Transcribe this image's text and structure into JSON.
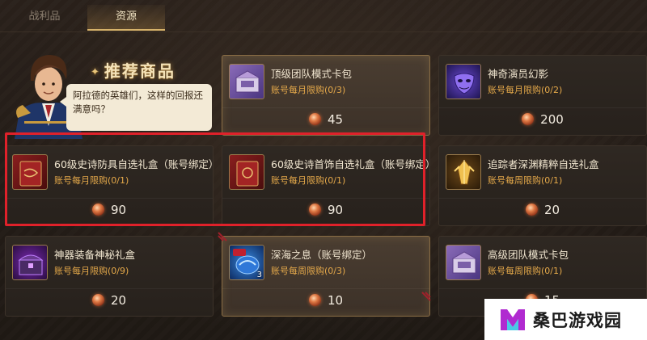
{
  "tabs": [
    {
      "label": "战利品",
      "active": false
    },
    {
      "label": "资源",
      "active": true
    }
  ],
  "promo": {
    "title": "推荐商品",
    "speech": "阿拉德的英雄们，这样的回报还满意吗？"
  },
  "items": [
    {
      "name": "顶级团队模式卡包",
      "limit": "账号每月限购(0/3)",
      "price": "45",
      "icon": "card-pack-box-icon",
      "selected": true
    },
    {
      "name": "神奇演员幻影",
      "limit": "账号每月限购(0/2)",
      "price": "200",
      "icon": "purple-mask-icon",
      "selected": false
    },
    {
      "name": "60级史诗防具自选礼盒（账号绑定）",
      "limit": "账号每月限购(0/1)",
      "price": "90",
      "icon": "red-gift-book-icon",
      "selected": false
    },
    {
      "name": "60级史诗首饰自选礼盒（账号绑定）",
      "limit": "账号每月限购(0/1)",
      "price": "90",
      "icon": "red-gift-book-icon",
      "selected": false
    },
    {
      "name": "追踪者深渊精粹自选礼盒",
      "limit": "账号每周限购(0/1)",
      "price": "20",
      "icon": "golden-crystal-icon",
      "selected": false
    },
    {
      "name": "神器装备神秘礼盒",
      "limit": "账号每月限购(0/9)",
      "price": "20",
      "icon": "purple-chest-icon",
      "selected": false
    },
    {
      "name": "深海之息（账号绑定）",
      "limit": "账号每周限购(0/3)",
      "price": "10",
      "icon": "blue-orb-icon",
      "badge": "3",
      "selected": true
    },
    {
      "name": "高级团队模式卡包",
      "limit": "账号每周限购(0/1)",
      "price": "15",
      "icon": "card-pack-box-icon",
      "selected": false
    }
  ],
  "currency_icon": "flame-coin-icon",
  "watermark": {
    "text": "桑巴游戏园"
  },
  "colors": {
    "limit_text": "#e5a94a",
    "highlight_border": "#e0212a",
    "tab_active_underline": "#d6b26a"
  }
}
